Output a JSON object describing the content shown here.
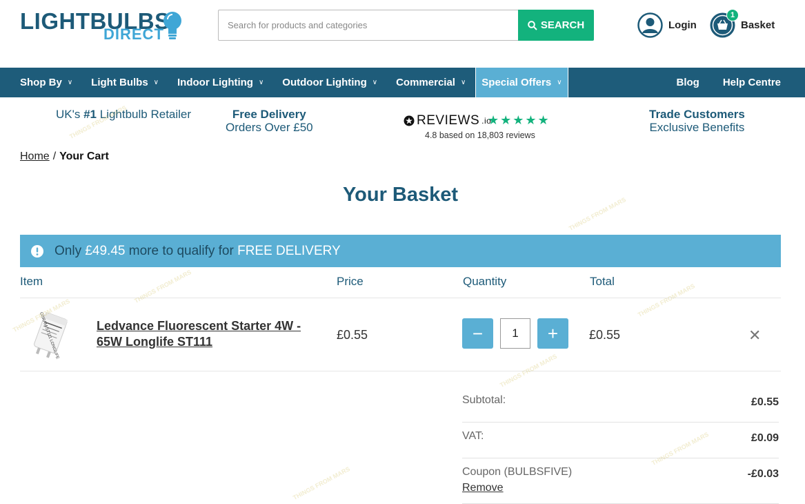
{
  "logo": {
    "line1": "LIGHTBULBS",
    "line2": "DIRECT"
  },
  "search": {
    "placeholder": "Search for products and categories",
    "button_label": "SEARCH"
  },
  "account": {
    "login_label": "Login",
    "basket_label": "Basket",
    "basket_count": "1"
  },
  "nav": {
    "items": [
      "Shop By",
      "Light Bulbs",
      "Indoor Lighting",
      "Outdoor Lighting",
      "Commercial"
    ],
    "special": "Special Offers",
    "right": [
      "Blog",
      "Help Centre"
    ]
  },
  "usp": {
    "retailer_pre": "UK's ",
    "retailer_bold": "#1",
    "retailer_post": " Lightbulb Retailer",
    "delivery_title": "Free Delivery",
    "delivery_sub": "Orders Over £50",
    "reviews_brand": "REVIEWS",
    "reviews_suffix": ".io",
    "reviews_stars": "★★★★★",
    "reviews_sub": "4.8 based on 18,803 reviews",
    "trade_title": "Trade Customers",
    "trade_sub": "Exclusive Benefits"
  },
  "breadcrumb": {
    "home": "Home",
    "sep": "/",
    "current": "Your Cart"
  },
  "page_title": "Your Basket",
  "notice": {
    "pre": "Only ",
    "amount": "£49.45",
    "mid": " more to qualify for ",
    "free": "FREE DELIVERY"
  },
  "columns": {
    "item": "Item",
    "price": "Price",
    "quantity": "Quantity",
    "total": "Total"
  },
  "cart_item": {
    "name_line1": "Ledvance Fluorescent Starter 4W -",
    "name_line2": "65W Longlife ST111",
    "price": "£0.55",
    "quantity": "1",
    "total": "£0.55",
    "label_text": "OSRAM ST111 LONGLIFE"
  },
  "summary": {
    "subtotal_label": "Subtotal:",
    "subtotal_value": "£0.55",
    "vat_label": "VAT:",
    "vat_value": "£0.09",
    "coupon_label": "Coupon (BULBSFIVE)",
    "coupon_value": "-£0.03",
    "remove_label": "Remove"
  },
  "colors": {
    "brand_dark": "#1d5a78",
    "brand_light": "#5aafd4",
    "accent_green": "#13b27d"
  },
  "watermark": "THINGS FROM MARS"
}
